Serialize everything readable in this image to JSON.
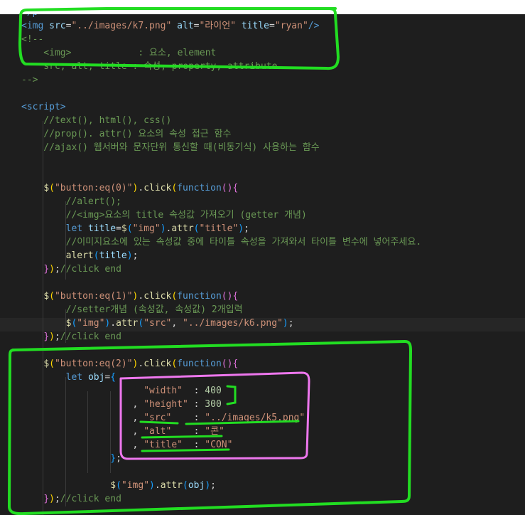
{
  "editor": {
    "code": [
      [
        [
          "</p>",
          "tag"
        ]
      ],
      [
        [
          "<img ",
          "tag"
        ],
        [
          "src",
          "attr"
        ],
        [
          "=",
          "pn"
        ],
        [
          "\"../images/k7.png\"",
          "str"
        ],
        [
          " ",
          "pn"
        ],
        [
          "alt",
          "attr"
        ],
        [
          "=",
          "pn"
        ],
        [
          "\"라이언\"",
          "str"
        ],
        [
          " ",
          "pn"
        ],
        [
          "title",
          "attr"
        ],
        [
          "=",
          "pn"
        ],
        [
          "\"ryan\"",
          "str"
        ],
        [
          "/>",
          "tag"
        ]
      ],
      [
        [
          "<!--",
          "cmt"
        ]
      ],
      [
        [
          "    <img>            : 요소, element",
          "cmt"
        ]
      ],
      [
        [
          "    src, alt, title : 속성, property, attribute",
          "cmt"
        ]
      ],
      [
        [
          "-->",
          "cmt"
        ]
      ],
      [],
      [
        [
          "<script>",
          "tag"
        ]
      ],
      [
        [
          "    //text(), html(), css()",
          "cmt"
        ]
      ],
      [
        [
          "    //prop(). attr() 요소의 속성 접근 함수",
          "cmt"
        ]
      ],
      [
        [
          "    //ajax() 웹서버와 문자단위 통신할 때(비동기식) 사용하는 함수",
          "cmt"
        ]
      ],
      [],
      [],
      [
        [
          "    ",
          "pn"
        ],
        [
          "$",
          "fn"
        ],
        [
          "(",
          "br1"
        ],
        [
          "\"button:eq(0)\"",
          "str"
        ],
        [
          ")",
          "br1"
        ],
        [
          ".",
          "pn"
        ],
        [
          "click",
          "fn"
        ],
        [
          "(",
          "br1"
        ],
        [
          "function",
          "kw"
        ],
        [
          "(",
          "br2"
        ],
        [
          ")",
          "br2"
        ],
        [
          "{",
          "br2"
        ]
      ],
      [
        [
          "        //alert();",
          "cmt"
        ]
      ],
      [
        [
          "        //<img>요소의 title 속성값 가져오기 (getter 개념)",
          "cmt"
        ]
      ],
      [
        [
          "        ",
          "pn"
        ],
        [
          "let",
          "kw"
        ],
        [
          " ",
          "pn"
        ],
        [
          "title",
          "var"
        ],
        [
          "=",
          "pn"
        ],
        [
          "$",
          "fn"
        ],
        [
          "(",
          "br3"
        ],
        [
          "\"img\"",
          "str"
        ],
        [
          ")",
          "br3"
        ],
        [
          ".",
          "pn"
        ],
        [
          "attr",
          "fn"
        ],
        [
          "(",
          "br3"
        ],
        [
          "\"title\"",
          "str"
        ],
        [
          ")",
          "br3"
        ],
        [
          ";",
          "pn"
        ]
      ],
      [
        [
          "        //이미지요소에 있는 속성값 중에 타이틀 속성을 가져와서 타이틀 변수에 넣어주세요.",
          "cmt"
        ]
      ],
      [
        [
          "        ",
          "pn"
        ],
        [
          "alert",
          "fn"
        ],
        [
          "(",
          "br3"
        ],
        [
          "title",
          "var"
        ],
        [
          ")",
          "br3"
        ],
        [
          ";",
          "pn"
        ]
      ],
      [
        [
          "    ",
          "pn"
        ],
        [
          "}",
          "br2"
        ],
        [
          ")",
          "br1"
        ],
        [
          ";",
          "pn"
        ],
        [
          "//click end",
          "cmt"
        ]
      ],
      [],
      [
        [
          "    ",
          "pn"
        ],
        [
          "$",
          "fn"
        ],
        [
          "(",
          "br1"
        ],
        [
          "\"button:eq(1)\"",
          "str"
        ],
        [
          ")",
          "br1"
        ],
        [
          ".",
          "pn"
        ],
        [
          "click",
          "fn"
        ],
        [
          "(",
          "br1"
        ],
        [
          "function",
          "kw"
        ],
        [
          "(",
          "br2"
        ],
        [
          ")",
          "br2"
        ],
        [
          "{",
          "br2"
        ]
      ],
      [
        [
          "        //setter개념 (속성값, 속성값) 2개입력",
          "cmt"
        ]
      ],
      [
        [
          "        ",
          "pn"
        ],
        [
          "$",
          "fn"
        ],
        [
          "(",
          "br3"
        ],
        [
          "\"img\"",
          "str"
        ],
        [
          ")",
          "br3"
        ],
        [
          ".",
          "pn"
        ],
        [
          "attr",
          "fn"
        ],
        [
          "(",
          "br3"
        ],
        [
          "\"src\"",
          "str"
        ],
        [
          ", ",
          "pn"
        ],
        [
          "\"../images/k6.png\"",
          "str"
        ],
        [
          ")",
          "br3"
        ],
        [
          ";",
          "pn"
        ]
      ],
      [
        [
          "    ",
          "pn"
        ],
        [
          "}",
          "br2"
        ],
        [
          ")",
          "br1"
        ],
        [
          ";",
          "pn"
        ],
        [
          "//click end",
          "cmt"
        ]
      ],
      [],
      [
        [
          "    ",
          "pn"
        ],
        [
          "$",
          "fn"
        ],
        [
          "(",
          "br1"
        ],
        [
          "\"button:eq(2)\"",
          "str"
        ],
        [
          ")",
          "br1"
        ],
        [
          ".",
          "pn"
        ],
        [
          "click",
          "fn"
        ],
        [
          "(",
          "br1"
        ],
        [
          "function",
          "kw"
        ],
        [
          "(",
          "br2"
        ],
        [
          ")",
          "br2"
        ],
        [
          "{",
          "br2"
        ]
      ],
      [
        [
          "        ",
          "pn"
        ],
        [
          "let",
          "kw"
        ],
        [
          " ",
          "pn"
        ],
        [
          "obj",
          "var"
        ],
        [
          "=",
          "pn"
        ],
        [
          "{",
          "br3"
        ]
      ],
      [
        [
          "                      ",
          "pn"
        ],
        [
          "\"width\"",
          "str"
        ],
        [
          "  : ",
          "pn"
        ],
        [
          "400",
          "num"
        ]
      ],
      [
        [
          "                    , ",
          "pn"
        ],
        [
          "\"height\"",
          "str"
        ],
        [
          " : ",
          "pn"
        ],
        [
          "300",
          "num"
        ]
      ],
      [
        [
          "                    , ",
          "pn"
        ],
        [
          "\"src\"",
          "str"
        ],
        [
          "    : ",
          "pn"
        ],
        [
          "\"../images/k5.png\"",
          "str"
        ]
      ],
      [
        [
          "                    , ",
          "pn"
        ],
        [
          "\"alt\"",
          "str"
        ],
        [
          "    : ",
          "pn"
        ],
        [
          "\"콘\"",
          "str"
        ]
      ],
      [
        [
          "                    , ",
          "pn"
        ],
        [
          "\"title\"",
          "str"
        ],
        [
          "  : ",
          "pn"
        ],
        [
          "\"CON\"",
          "str"
        ]
      ],
      [
        [
          "                ",
          "pn"
        ],
        [
          "}",
          "br3"
        ],
        [
          ";",
          "pn"
        ]
      ],
      [],
      [
        [
          "                ",
          "pn"
        ],
        [
          "$",
          "fn"
        ],
        [
          "(",
          "br3"
        ],
        [
          "\"img\"",
          "str"
        ],
        [
          ")",
          "br3"
        ],
        [
          ".",
          "pn"
        ],
        [
          "attr",
          "fn"
        ],
        [
          "(",
          "br3"
        ],
        [
          "obj",
          "var"
        ],
        [
          ")",
          "br3"
        ],
        [
          ";",
          "pn"
        ]
      ],
      [
        [
          "    ",
          "pn"
        ],
        [
          "}",
          "br2"
        ],
        [
          ")",
          "br1"
        ],
        [
          ";",
          "pn"
        ],
        [
          "//click end",
          "cmt"
        ]
      ]
    ]
  },
  "colors": {
    "editor_bg": "#1e1e1e",
    "annotation_green": "#22dd22",
    "annotation_pink": "#ee77ee"
  }
}
